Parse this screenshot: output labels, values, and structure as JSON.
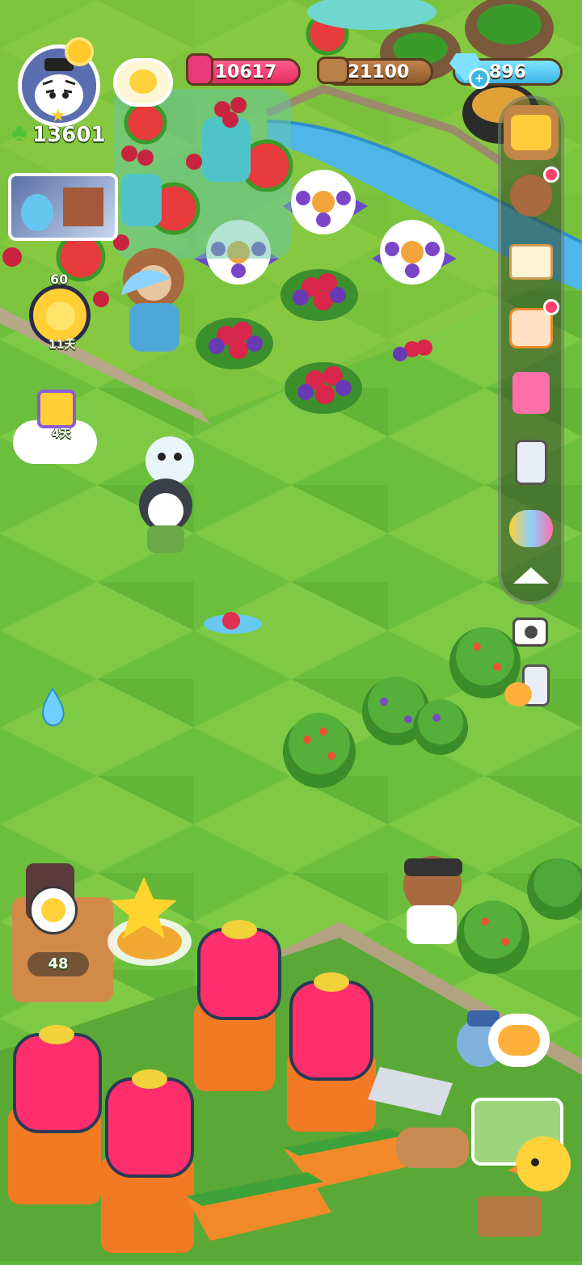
{
  "hud": {
    "player_level": "13601",
    "gems": "10617",
    "wood": "21100",
    "diamonds": "896",
    "diamond_plus": "+"
  },
  "left_widgets": {
    "chick_badge_level": "60",
    "chick_badge_days": "11天",
    "gift_days": "4天"
  },
  "bottom": {
    "workbench_count": "48"
  },
  "colors": {
    "grass_light": "#8fd14a",
    "grass_dark": "#5fb53a",
    "river": "#4fb6ea",
    "accent_pink": "#ff3f6c"
  },
  "icons": {
    "avatar": "tiger-avatar-icon",
    "side_menu": [
      "shop-stall-icon",
      "bear-friends-icon",
      "news-icon",
      "calendar-30-icon",
      "cards-icon",
      "devices-icon",
      "pets-icon",
      "collapse-arrow-icon"
    ],
    "extra": [
      "camera-icon",
      "phone-swap-icon"
    ]
  }
}
